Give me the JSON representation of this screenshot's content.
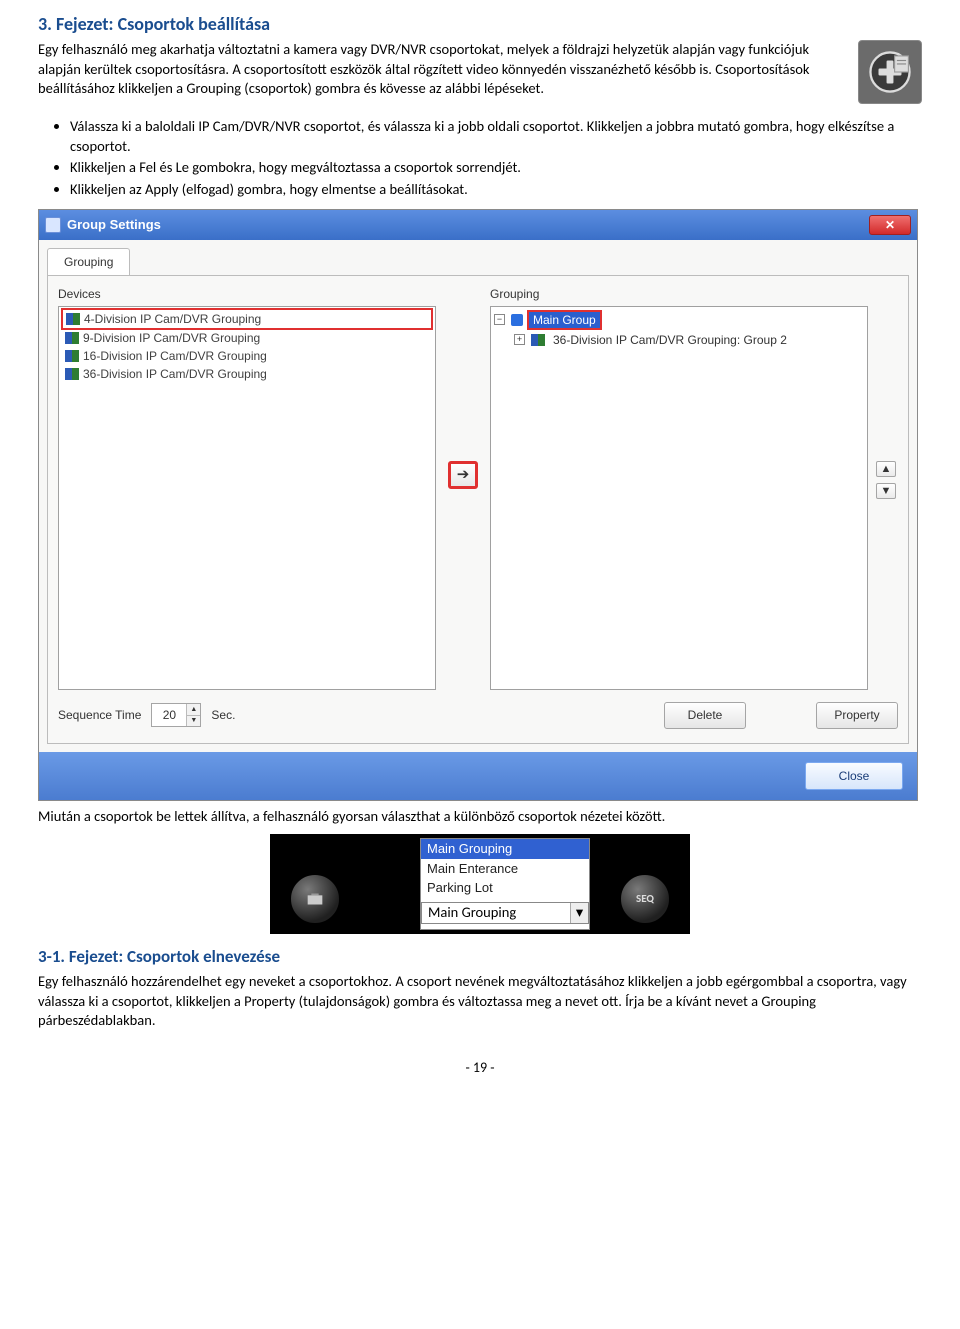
{
  "heading3": "3. Fejezet: Csoportok beállítása",
  "intro": {
    "p1": "Egy felhasználó meg akarhatja változtatni a kamera vagy DVR/NVR csoportokat, melyek a földrajzi helyzetük alapján vagy funkciójuk alapján kerültek csoportosításra. A csoportosított eszközök által rögzített video könnyedén visszanézhető később is. Csoportosítások beállításához klikkeljen a Grouping (csoportok) gombra és kövesse az alábbi lépéseket."
  },
  "bullets": {
    "b1a": "Válassza ki a baloldali IP Cam/DVR/NVR csoportot, és válassza ki a jobb oldali csoportot. Klikkeljen a jobbra mutató gombra, hogy elkészítse a csoportot.",
    "b2": "Klikkeljen a Fel és Le gombokra, hogy megváltoztassa a csoportok sorrendjét.",
    "b3": "Klikkeljen az Apply (elfogad) gombra, hogy elmentse a beállításokat."
  },
  "dialog": {
    "title": "Group Settings",
    "tab": "Grouping",
    "devices_label": "Devices",
    "grouping_label": "Grouping",
    "devices": [
      "4-Division IP Cam/DVR Grouping",
      "9-Division IP Cam/DVR Grouping",
      "16-Division IP Cam/DVR Grouping",
      "36-Division IP Cam/DVR Grouping"
    ],
    "groups": {
      "main": "Main Group",
      "sub": "36-Division IP Cam/DVR Grouping: Group 2"
    },
    "seq_label": "Sequence Time",
    "seq_value": "20",
    "seq_unit": "Sec.",
    "delete_btn": "Delete",
    "property_btn": "Property",
    "close_btn": "Close",
    "arrow_right": "➔",
    "arrow_up": "▲",
    "arrow_down": "▼"
  },
  "after_dialog": "Miután a csoportok be lettek állítva, a felhasználó gyorsan választhat a különböző csoportok nézetei között.",
  "toolbar": {
    "options": {
      "o1": "Main Grouping",
      "o2": "Main Enterance",
      "o3": "Parking Lot"
    },
    "selected": "Main Grouping",
    "seq_label": "SEQ"
  },
  "heading31": "3-1. Fejezet: Csoportok elnevezése",
  "p31": "Egy felhasználó hozzárendelhet egy neveket a csoportokhoz. A csoport nevének megváltoztatásához klikkeljen a jobb egérgombbal a csoportra, vagy válassza ki a csoportot, klikkeljen a Property (tulajdonságok) gombra és változtassa meg a nevet ott. Írja be a kívánt nevet a Grouping párbeszédablakban.",
  "pagenum": "- 19 -"
}
